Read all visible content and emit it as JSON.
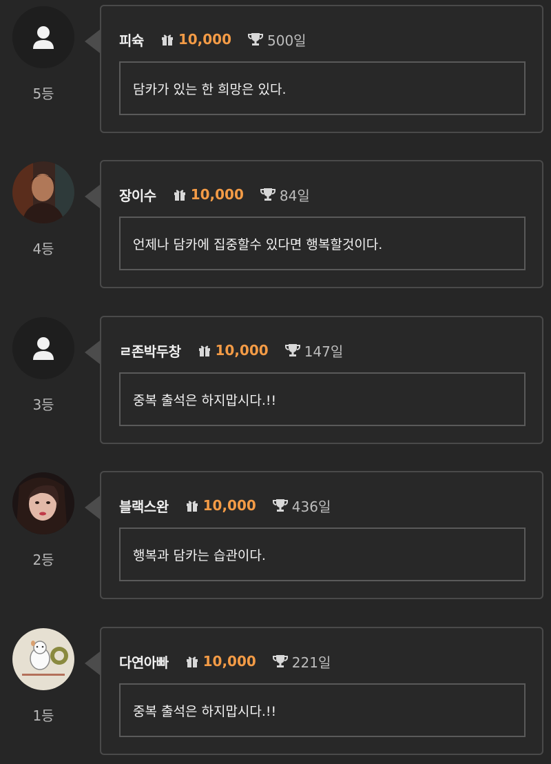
{
  "colors": {
    "background": "#262626",
    "card_border": "#4a4a4a",
    "points_accent": "#f39b46",
    "text_primary": "#f0f0f0",
    "text_secondary": "#bdbdbd"
  },
  "icons": {
    "gift": "gift-icon",
    "trophy": "trophy-icon",
    "default_avatar": "user-silhouette-icon"
  },
  "entries": [
    {
      "rank": "5등",
      "name": "피슉",
      "points": "10,000",
      "days": "500일",
      "message": "담카가 있는 한 희망은 있다.",
      "avatar": "default"
    },
    {
      "rank": "4등",
      "name": "장이수",
      "points": "10,000",
      "days": "84일",
      "message": "언제나 담카에 집중할수 있다면 행복할것이다.",
      "avatar": "photo"
    },
    {
      "rank": "3등",
      "name": "ㄹ존박두창",
      "points": "10,000",
      "days": "147일",
      "message": "중복 출석은 하지맙시다.!!",
      "avatar": "default"
    },
    {
      "rank": "2등",
      "name": "블랙스완",
      "points": "10,000",
      "days": "436일",
      "message": "행복과 담카는 습관이다.",
      "avatar": "photo"
    },
    {
      "rank": "1등",
      "name": "다연아빠",
      "points": "10,000",
      "days": "221일",
      "message": "중복 출석은 하지맙시다.!!",
      "avatar": "photo"
    }
  ]
}
